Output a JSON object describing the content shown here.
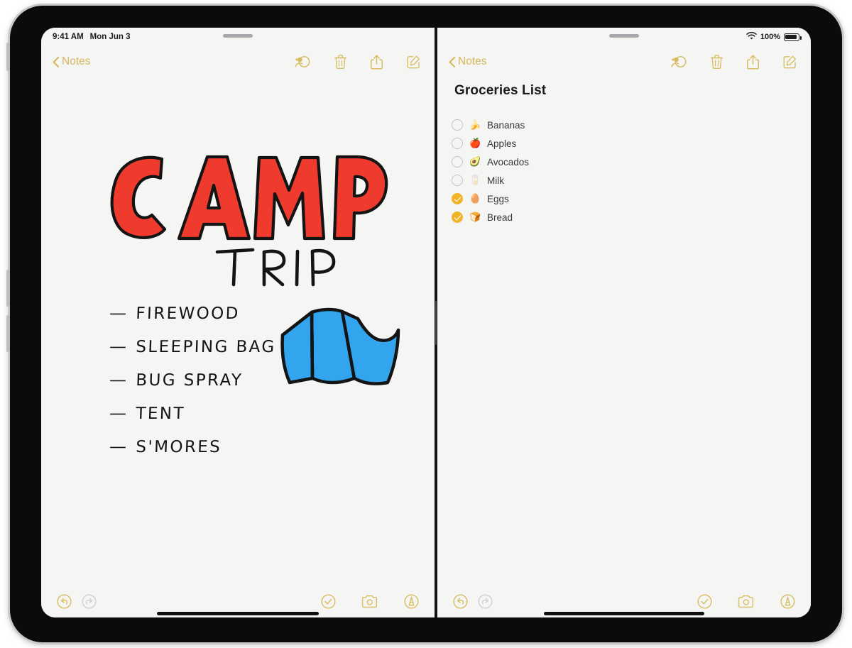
{
  "status_bar": {
    "time": "9:41 AM",
    "date": "Mon Jun 3",
    "battery_percent": "100%",
    "wifi_icon": "wifi-icon",
    "battery_icon": "battery-icon"
  },
  "colors": {
    "accent": "#d5b85c",
    "checkbox_checked": "#f0b429",
    "paper": "#f5f5f3",
    "camp_red": "#ee3b2e",
    "tent_blue": "#33a5ee",
    "ink": "#141414"
  },
  "left_pane": {
    "back_label": "Notes",
    "nav_icons": [
      {
        "name": "add-collaborator-icon",
        "label": "Add People"
      },
      {
        "name": "trash-icon",
        "label": "Delete"
      },
      {
        "name": "share-icon",
        "label": "Share"
      },
      {
        "name": "compose-icon",
        "label": "New Note"
      }
    ],
    "drawing": {
      "title_word": "CAMP",
      "subtitle_word": "TRIP",
      "illustration": "tent-illustration"
    },
    "handwritten_items": [
      {
        "dash": "—",
        "text": "FIREWOOD"
      },
      {
        "dash": "—",
        "text": "SLEEPING BAG"
      },
      {
        "dash": "—",
        "text": "BUG SPRAY"
      },
      {
        "dash": "—",
        "text": "TENT"
      },
      {
        "dash": "—",
        "text": "S'MORES"
      }
    ],
    "bottom_bar": {
      "undo_icon": "undo-icon",
      "redo_icon": "redo-icon",
      "checklist_icon": "checklist-icon",
      "camera_icon": "camera-icon",
      "markup_icon": "markup-icon"
    }
  },
  "right_pane": {
    "back_label": "Notes",
    "note_title": "Groceries List",
    "nav_icons": [
      {
        "name": "add-collaborator-icon",
        "label": "Add People"
      },
      {
        "name": "trash-icon",
        "label": "Delete"
      },
      {
        "name": "share-icon",
        "label": "Share"
      },
      {
        "name": "compose-icon",
        "label": "New Note"
      }
    ],
    "checklist": [
      {
        "checked": false,
        "emoji": "🍌",
        "label": "Bananas"
      },
      {
        "checked": false,
        "emoji": "🍎",
        "label": "Apples"
      },
      {
        "checked": false,
        "emoji": "🥑",
        "label": "Avocados"
      },
      {
        "checked": false,
        "emoji": "🥛",
        "label": "Milk"
      },
      {
        "checked": true,
        "emoji": "🥚",
        "label": "Eggs"
      },
      {
        "checked": true,
        "emoji": "🍞",
        "label": "Bread"
      }
    ],
    "bottom_bar": {
      "undo_icon": "undo-icon",
      "redo_icon": "redo-icon",
      "checklist_icon": "checklist-icon",
      "camera_icon": "camera-icon",
      "markup_icon": "markup-icon"
    }
  }
}
